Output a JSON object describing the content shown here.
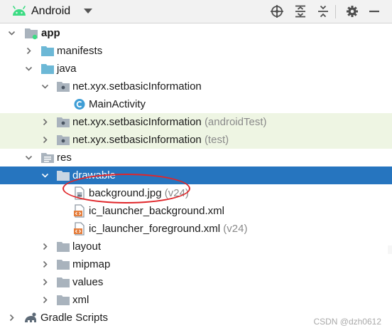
{
  "toolbar": {
    "view_label": "Android",
    "icons": [
      "target-icon",
      "expand-all-icon",
      "collapse-all-icon",
      "gear-icon",
      "minimize-icon"
    ]
  },
  "tree": {
    "app": "app",
    "manifests": "manifests",
    "java": "java",
    "pkg_main": "net.xyx.setbasicInformation",
    "main_activity": "MainActivity",
    "pkg_android_test": "net.xyx.setbasicInformation",
    "pkg_android_test_suffix": "(androidTest)",
    "pkg_test": "net.xyx.setbasicInformation",
    "pkg_test_suffix": "(test)",
    "res": "res",
    "drawable": "drawable",
    "background": "background.jpg",
    "background_suffix": "(v24)",
    "ic_bg": "ic_launcher_background.xml",
    "ic_fg": "ic_launcher_foreground.xml",
    "ic_fg_suffix": "(v24)",
    "layout": "layout",
    "mipmap": "mipmap",
    "values": "values",
    "xml": "xml",
    "gradle": "Gradle Scripts"
  },
  "watermark": "CSDN @dzh0612",
  "colors": {
    "selection": "#2675bf",
    "row_tint": "#eef5e3",
    "folder": "#a9b3bd",
    "java_folder": "#6cb8d6",
    "class_icon": "#3f9ed6",
    "android": "#3ddc84",
    "xml_icon": "#e57d3b",
    "annotation": "#e0262a"
  }
}
